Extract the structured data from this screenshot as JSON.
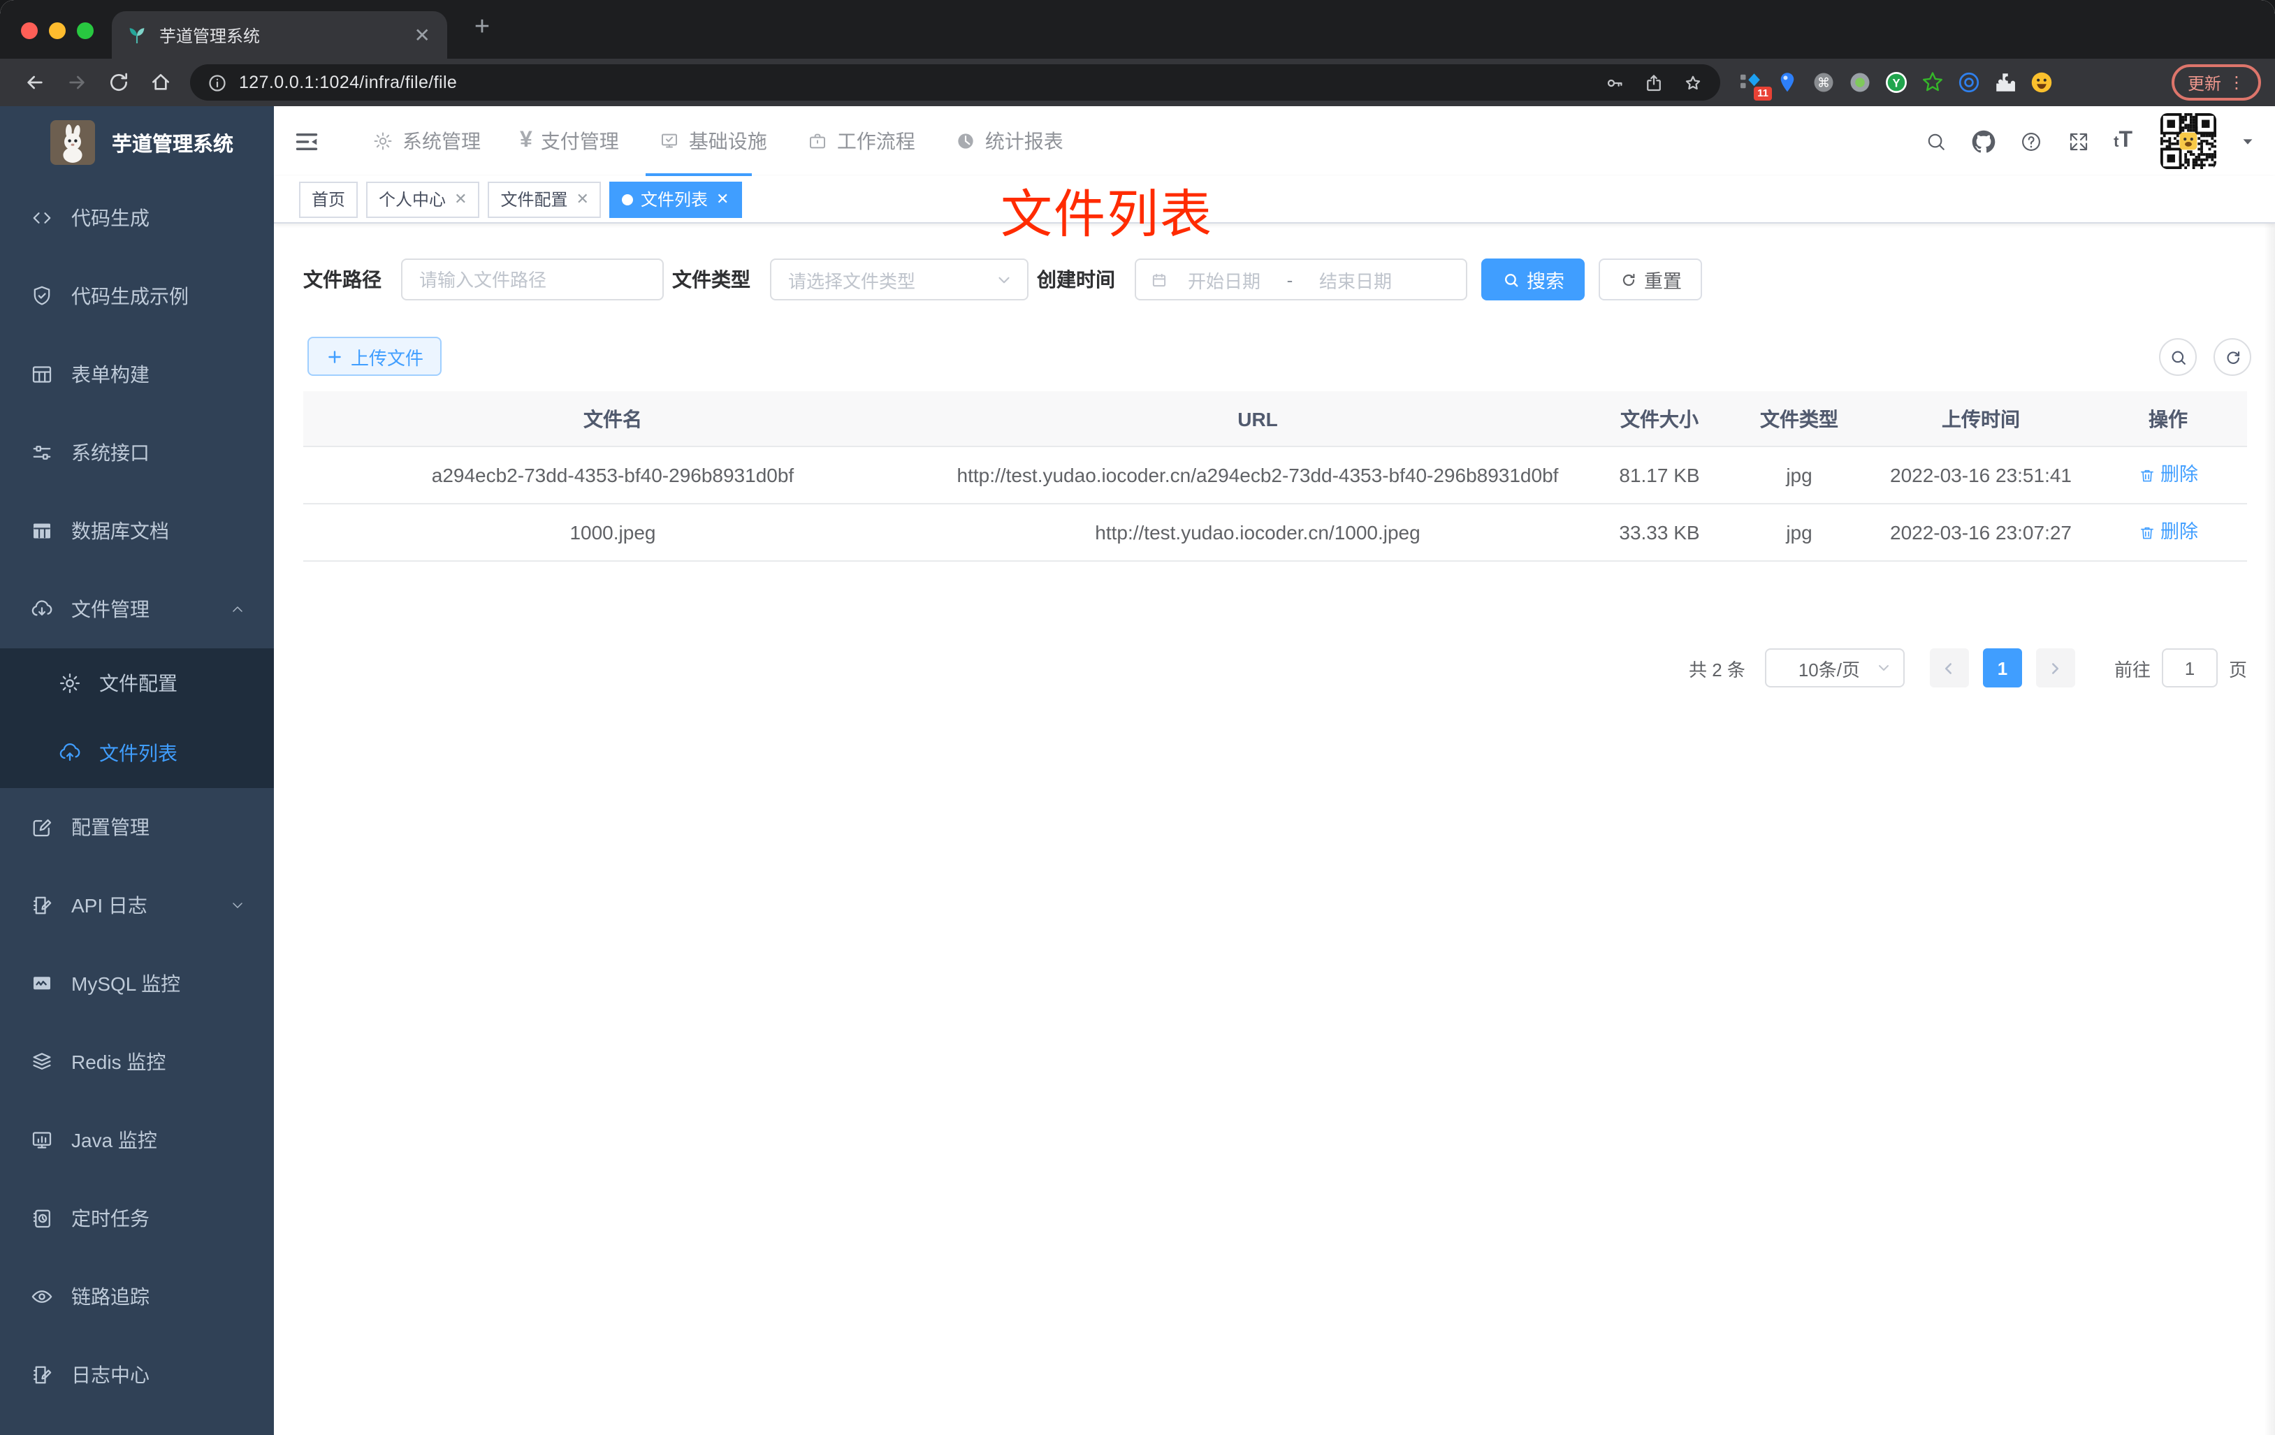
{
  "colors": {
    "accent": "#409eff",
    "sidebar_bg": "#304156",
    "submenu_bg": "#1f2d3d",
    "sidebar_text": "#bfcbd9",
    "annotation_red": "#ff2b00",
    "table_header_bg": "#f8f8f9",
    "tag_active_bg": "#409eff"
  },
  "browser": {
    "tab": {
      "title": "芋道管理系统",
      "favicon": "sprout-icon"
    },
    "url": "127.0.0.1:1024/infra/file/file",
    "traffic_lights": [
      "close",
      "minimize",
      "zoom"
    ],
    "extensions": [
      {
        "name": "blue-diamond-extension",
        "badge": "11"
      },
      {
        "name": "blue-pin-extension"
      },
      {
        "name": "command-extension"
      },
      {
        "name": "gray-dot-extension"
      },
      {
        "name": "green-y-extension"
      },
      {
        "name": "green-star-extension"
      },
      {
        "name": "blue-eye-extension"
      },
      {
        "name": "puzzle-extension"
      },
      {
        "name": "emoji-extension"
      }
    ],
    "update_button": {
      "label": "更新",
      "menu_icon": "kebab-menu-icon"
    }
  },
  "sidebar": {
    "logo_title": "芋道管理系统",
    "items": [
      {
        "icon": "code-icon",
        "label": "代码生成"
      },
      {
        "icon": "shield-check-icon",
        "label": "代码生成示例"
      },
      {
        "icon": "form-icon",
        "label": "表单构建"
      },
      {
        "icon": "sliders-icon",
        "label": "系统接口"
      },
      {
        "icon": "database-table-icon",
        "label": "数据库文档"
      },
      {
        "icon": "cloud-download-icon",
        "label": "文件管理",
        "arrow": "up"
      },
      {
        "icon": "gear-icon",
        "label": "文件配置",
        "sub": true
      },
      {
        "icon": "cloud-upload-icon",
        "label": "文件列表",
        "sub": true,
        "active": true
      },
      {
        "icon": "edit-square-icon",
        "label": "配置管理"
      },
      {
        "icon": "log-edit-icon",
        "label": "API 日志",
        "arrow": "down"
      },
      {
        "icon": "monitor-line-icon",
        "label": "MySQL 监控"
      },
      {
        "icon": "layers-icon",
        "label": "Redis 监控"
      },
      {
        "icon": "monitor-bar-icon",
        "label": "Java 监控"
      },
      {
        "icon": "schedule-icon",
        "label": "定时任务"
      },
      {
        "icon": "eye-icon",
        "label": "链路追踪"
      },
      {
        "icon": "log-center-icon",
        "label": "日志中心"
      }
    ]
  },
  "header": {
    "menu": [
      {
        "icon": "gear-icon",
        "label": "系统管理"
      },
      {
        "icon": "yen-icon",
        "label": "支付管理"
      },
      {
        "icon": "monitor-check-icon",
        "label": "基础设施",
        "active": true
      },
      {
        "icon": "briefcase-icon",
        "label": "工作流程"
      },
      {
        "icon": "dashboard-icon",
        "label": "统计报表"
      }
    ],
    "tools": [
      "search-icon",
      "github-icon",
      "help-icon",
      "fullscreen-icon",
      "font-size-icon"
    ],
    "font_size_text": "tT",
    "avatar": "qr-code-avatar"
  },
  "tags": [
    {
      "label": "首页",
      "closable": false
    },
    {
      "label": "个人中心",
      "closable": true
    },
    {
      "label": "文件配置",
      "closable": true
    },
    {
      "label": "文件列表",
      "closable": true,
      "active": true
    }
  ],
  "annotation": {
    "text": "文件列表"
  },
  "filters": {
    "path": {
      "label": "文件路径",
      "placeholder": "请输入文件路径"
    },
    "type": {
      "label": "文件类型",
      "placeholder": "请选择文件类型"
    },
    "date": {
      "label": "创建时间",
      "start_placeholder": "开始日期",
      "separator": "-",
      "end_placeholder": "结束日期"
    },
    "search_label": "搜索",
    "reset_label": "重置"
  },
  "toolbar": {
    "upload_label": "上传文件"
  },
  "table": {
    "columns": [
      "文件名",
      "URL",
      "文件大小",
      "文件类型",
      "上传时间",
      "操作"
    ],
    "rows": [
      {
        "name": "a294ecb2-73dd-4353-bf40-296b8931d0bf",
        "url": "http://test.yudao.iocoder.cn/a294ecb2-73dd-4353-bf40-296b8931d0bf",
        "size": "81.17 KB",
        "type": "jpg",
        "time": "2022-03-16 23:51:41",
        "action": "删除"
      },
      {
        "name": "1000.jpeg",
        "url": "http://test.yudao.iocoder.cn/1000.jpeg",
        "size": "33.33 KB",
        "type": "jpg",
        "time": "2022-03-16 23:07:27",
        "action": "删除"
      }
    ]
  },
  "pagination": {
    "total": "共 2 条",
    "page_size": "10条/页",
    "current": "1",
    "goto_label": "前往",
    "goto_value": "1",
    "unit": "页"
  }
}
